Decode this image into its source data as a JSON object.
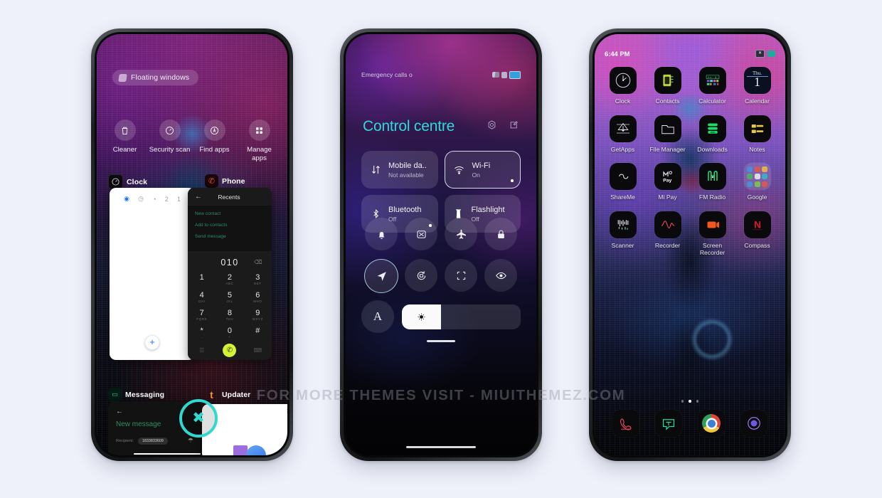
{
  "page": {
    "watermark": "FOR MORE THEMES VISIT - MIUITHEMEZ.COM",
    "background_color": "#eef1fa"
  },
  "phone1": {
    "name": "recents-screen",
    "floating_windows_chip": "Floating windows",
    "shortcuts": [
      {
        "label": "Cleaner",
        "icon": "trash-icon"
      },
      {
        "label": "Security scan",
        "icon": "speedometer-icon"
      },
      {
        "label": "Find apps",
        "icon": "search-circle-icon"
      },
      {
        "label": "Manage apps",
        "icon": "grid-apps-icon"
      }
    ],
    "tasks": [
      {
        "label": "Clock",
        "icon": "clock-app-icon"
      },
      {
        "label": "Phone",
        "icon": "phone-app-icon"
      },
      {
        "label": "Messaging",
        "icon": "messaging-app-icon"
      },
      {
        "label": "Updater",
        "icon": "updater-app-icon"
      }
    ],
    "clock_card": {
      "tabs": [
        "alarm-icon",
        "clock-icon",
        "stopwatch-icon",
        "2",
        "1"
      ],
      "add_button": "+"
    },
    "dialer_card": {
      "back": "←",
      "title": "Recents",
      "menu": [
        "New contact",
        "Add to contacts",
        "Send message"
      ],
      "number": "010",
      "delete": "⌫",
      "keys": [
        {
          "digit": "1",
          "sub": ""
        },
        {
          "digit": "2",
          "sub": "ABC"
        },
        {
          "digit": "3",
          "sub": "DEF"
        },
        {
          "digit": "4",
          "sub": "GHI"
        },
        {
          "digit": "5",
          "sub": "JKL"
        },
        {
          "digit": "6",
          "sub": "MNO"
        },
        {
          "digit": "7",
          "sub": "PQRS"
        },
        {
          "digit": "8",
          "sub": "TUV"
        },
        {
          "digit": "9",
          "sub": "WXYZ"
        },
        {
          "digit": "*",
          "sub": ","
        },
        {
          "digit": "0",
          "sub": "+"
        },
        {
          "digit": "#",
          "sub": ""
        }
      ],
      "call_button": "✆"
    },
    "message_card": {
      "back": "←",
      "title": "New message",
      "recipient_label": "Recipient:",
      "recipient_chip": "1833833609",
      "contact_icon": "person-icon"
    },
    "gallery_card": {
      "menu": "⋮"
    },
    "close_button": "✖"
  },
  "phone2": {
    "name": "control-centre",
    "statusbar": {
      "left": "Emergency calls o",
      "icons": [
        "signal-icon",
        "shield-icon",
        "battery-icon"
      ]
    },
    "title": "Control centre",
    "header_actions": [
      "settings-gear-icon",
      "edit-pencil-icon"
    ],
    "tiles": [
      {
        "title": "Mobile da..",
        "subtitle": "Not available",
        "icon": "mobile-data-icon",
        "active": false,
        "dot": false
      },
      {
        "title": "Wi-Fi",
        "subtitle": "On",
        "icon": "wifi-icon",
        "active": true,
        "dot": true
      },
      {
        "title": "Bluetooth",
        "subtitle": "Off",
        "icon": "bluetooth-icon",
        "active": false,
        "dot": true
      },
      {
        "title": "Flashlight",
        "subtitle": "Off",
        "icon": "flashlight-icon",
        "active": false,
        "dot": false
      }
    ],
    "toggles_row1": [
      {
        "icon": "bell-silent-icon",
        "active": false
      },
      {
        "icon": "screenshot-icon",
        "active": false
      },
      {
        "icon": "airplane-icon",
        "active": false
      },
      {
        "icon": "lock-icon",
        "active": false
      }
    ],
    "toggles_row2": [
      {
        "icon": "location-arrow-icon",
        "active": true
      },
      {
        "icon": "auto-rotate-icon",
        "active": false
      },
      {
        "icon": "scan-frame-icon",
        "active": false
      },
      {
        "icon": "eye-reading-mode-icon",
        "active": false
      }
    ],
    "brightness": {
      "auto_label": "A",
      "icon": "brightness-sun-icon",
      "level_percent": 33
    },
    "accent_color": "#2fd9d9"
  },
  "phone3": {
    "name": "home-screen",
    "statusbar": {
      "time": "6:44 PM",
      "icons": [
        "close-badge-icon",
        "green-badge-icon"
      ]
    },
    "apps": [
      {
        "label": "Clock",
        "icon": "clock-app-icon"
      },
      {
        "label": "Contacts",
        "icon": "contacts-app-icon"
      },
      {
        "label": "Calculator",
        "icon": "calculator-app-icon"
      },
      {
        "label": "Calendar",
        "icon": "calendar-app-icon"
      },
      {
        "label": "GetApps",
        "icon": "getapps-app-icon"
      },
      {
        "label": "File Manager",
        "icon": "file-manager-app-icon"
      },
      {
        "label": "Downloads",
        "icon": "downloads-app-icon"
      },
      {
        "label": "Notes",
        "icon": "notes-app-icon"
      },
      {
        "label": "ShareMe",
        "icon": "shareme-app-icon"
      },
      {
        "label": "Mi Pay",
        "icon": "mi-pay-app-icon"
      },
      {
        "label": "FM Radio",
        "icon": "fm-radio-app-icon"
      },
      {
        "label": "Google",
        "icon": "google-folder-icon"
      },
      {
        "label": "Scanner",
        "icon": "scanner-app-icon"
      },
      {
        "label": "Recorder",
        "icon": "recorder-app-icon"
      },
      {
        "label": "Screen Recorder",
        "icon": "screen-recorder-app-icon"
      },
      {
        "label": "Compass",
        "icon": "compass-app-icon"
      }
    ],
    "calendar_icon": {
      "weekday": "Thu.",
      "day": "1"
    },
    "page_dots": {
      "count": 3,
      "active_index": 1
    },
    "dock": [
      {
        "label": "Phone",
        "icon": "phone-dock-icon"
      },
      {
        "label": "Messaging",
        "icon": "messaging-dock-icon"
      },
      {
        "label": "Chrome",
        "icon": "chrome-dock-icon"
      },
      {
        "label": "Camera",
        "icon": "camera-dock-icon"
      }
    ]
  }
}
